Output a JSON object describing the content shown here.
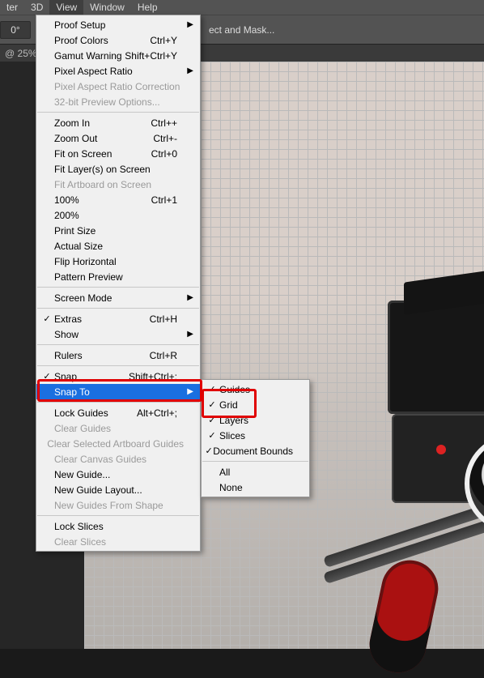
{
  "menubar": {
    "items": [
      "ter",
      "3D",
      "View",
      "Window",
      "Help"
    ],
    "active_index": 2
  },
  "optionsbar": {
    "angle": "0°",
    "select_mask": "ect and Mask..."
  },
  "tabstrip": {
    "label": "@ 25% ("
  },
  "view_menu": [
    {
      "label": "Proof Setup",
      "sub": true
    },
    {
      "label": "Proof Colors",
      "accel": "Ctrl+Y"
    },
    {
      "label": "Gamut Warning",
      "accel": "Shift+Ctrl+Y"
    },
    {
      "label": "Pixel Aspect Ratio",
      "sub": true
    },
    {
      "label": "Pixel Aspect Ratio Correction",
      "disabled": true
    },
    {
      "label": "32-bit Preview Options...",
      "disabled": true
    },
    {
      "sep": true
    },
    {
      "label": "Zoom In",
      "accel": "Ctrl++"
    },
    {
      "label": "Zoom Out",
      "accel": "Ctrl+-"
    },
    {
      "label": "Fit on Screen",
      "accel": "Ctrl+0"
    },
    {
      "label": "Fit Layer(s) on Screen"
    },
    {
      "label": "Fit Artboard on Screen",
      "disabled": true
    },
    {
      "label": "100%",
      "accel": "Ctrl+1"
    },
    {
      "label": "200%"
    },
    {
      "label": "Print Size"
    },
    {
      "label": "Actual Size"
    },
    {
      "label": "Flip Horizontal"
    },
    {
      "label": "Pattern Preview"
    },
    {
      "sep": true
    },
    {
      "label": "Screen Mode",
      "sub": true
    },
    {
      "sep": true
    },
    {
      "label": "Extras",
      "accel": "Ctrl+H",
      "checked": true
    },
    {
      "label": "Show",
      "sub": true
    },
    {
      "sep": true
    },
    {
      "label": "Rulers",
      "accel": "Ctrl+R"
    },
    {
      "sep": true
    },
    {
      "label": "Snap",
      "accel": "Shift+Ctrl+;",
      "checked": true
    },
    {
      "label": "Snap To",
      "sub": true,
      "highlight": true
    },
    {
      "sep": true
    },
    {
      "label": "Lock Guides",
      "accel": "Alt+Ctrl+;"
    },
    {
      "label": "Clear Guides",
      "disabled": true
    },
    {
      "label": "Clear Selected Artboard Guides",
      "disabled": true
    },
    {
      "label": "Clear Canvas Guides",
      "disabled": true
    },
    {
      "label": "New Guide..."
    },
    {
      "label": "New Guide Layout..."
    },
    {
      "label": "New Guides From Shape",
      "disabled": true
    },
    {
      "sep": true
    },
    {
      "label": "Lock Slices"
    },
    {
      "label": "Clear Slices",
      "disabled": true
    }
  ],
  "snapto_menu": [
    {
      "label": "Guides",
      "checked": true
    },
    {
      "label": "Grid",
      "checked": true,
      "callout": true
    },
    {
      "label": "Layers",
      "checked": true
    },
    {
      "label": "Slices",
      "checked": true
    },
    {
      "label": "Document Bounds",
      "checked": true
    },
    {
      "sep": true
    },
    {
      "label": "All"
    },
    {
      "label": "None"
    }
  ]
}
